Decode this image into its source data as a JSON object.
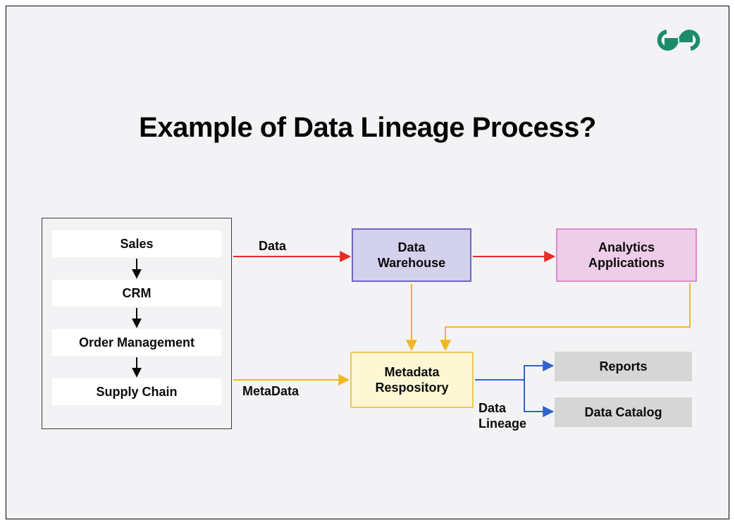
{
  "title": "Example of Data Lineage Process?",
  "sources": {
    "items": [
      "Sales",
      "CRM",
      "Order Management",
      "Supply Chain"
    ]
  },
  "nodes": {
    "data_warehouse": "Data\nWarehouse",
    "analytics": "Analytics\nApplications",
    "metadata_repo": "Metadata\nRespository",
    "reports": "Reports",
    "data_catalog": "Data Catalog"
  },
  "edge_labels": {
    "data": "Data",
    "metadata": "MetaData",
    "lineage": "Data\nLineage"
  },
  "colors": {
    "warehouse_bg": "#d3d1ec",
    "warehouse_border": "#6f66c4",
    "analytics_bg": "#eecde8",
    "analytics_border": "#d98dce",
    "metadata_bg": "#fdf7d3",
    "metadata_border": "#e9cb54",
    "grey_bg": "#d6d6d6",
    "red": "#e62c27",
    "yellow": "#f0b724",
    "blue": "#3262d1",
    "black": "#0a0a0a"
  }
}
